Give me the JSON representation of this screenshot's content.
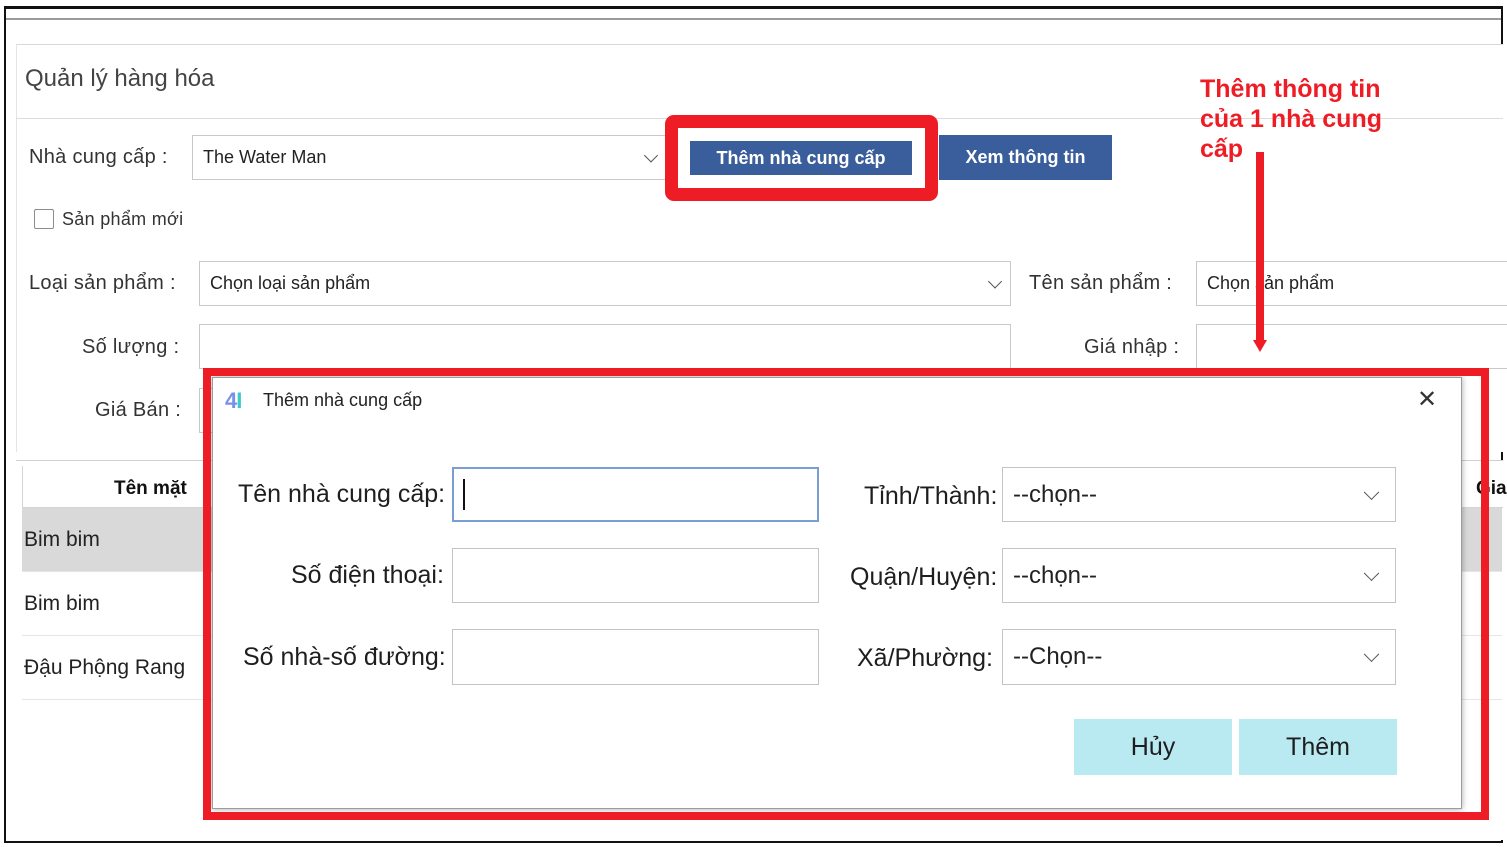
{
  "window": {
    "title": "Quản lý hàng hóa"
  },
  "form": {
    "supplier_label": "Nhà cung cấp :",
    "supplier_value": "The Water Man",
    "add_supplier_button": "Thêm nhà cung cấp",
    "view_info_button": "Xem thông tin",
    "new_product_checkbox": "Sản phẩm mới",
    "new_product_checked": false,
    "category_label": "Loại sản phẩm :",
    "category_value": "Chọn loại sản phẩm",
    "product_name_label": "Tên sản phẩm :",
    "product_name_value": "Chọn sản phẩm",
    "quantity_label": "Số lượng :",
    "import_price_label": "Giá nhập :",
    "sale_price_label": "Giá Bán :"
  },
  "table": {
    "columns": [
      "Tên mặt",
      "Gia"
    ],
    "rows": [
      "Bim bim",
      "Bim bim",
      "Đậu Phộng Rang"
    ]
  },
  "dialog": {
    "title": "Thêm nhà cung cấp",
    "logo_text": "4I",
    "close_glyph": "✕",
    "name_label": "Tên nhà cung cấp:",
    "phone_label": "Số điện thoại:",
    "address_label": "Số nhà-số đường:",
    "province_label": "Tỉnh/Thành:",
    "province_value": "--chọn--",
    "district_label": "Quận/Huyện:",
    "district_value": "--chọn--",
    "ward_label": "Xã/Phường:",
    "ward_value": "--Chọn--",
    "cancel_button": "Hủy",
    "add_button": "Thêm"
  },
  "annotation": {
    "line1": "Thêm thông tin",
    "line2": "của 1 nhà cung",
    "line3": "cấp",
    "color": "#ee1c24"
  },
  "colors": {
    "primary_button": "#3a5d9c",
    "dialog_button": "#b9eaf2",
    "highlight": "#ee1c24"
  }
}
